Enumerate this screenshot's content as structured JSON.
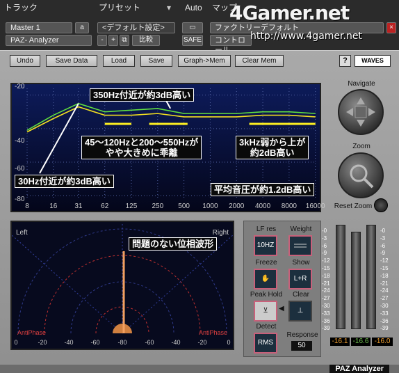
{
  "host": {
    "section_track": "トラック",
    "section_preset": "プリセット",
    "auto": "Auto",
    "section_map": "マップ",
    "track_name": "Master 1",
    "track_slot": "a",
    "insert_name": "PAZ- Analyzer",
    "preset_name": "<デフォルト設定>",
    "minus": "-",
    "plus": "+",
    "compare": "比較",
    "safe": "SAFE",
    "factory": "ファクトリーデフォルト",
    "control": "コントロール",
    "logo": "4Gamer.net",
    "url": "http://www.4gamer.net"
  },
  "toolbar": {
    "undo": "Undo",
    "save_data": "Save Data",
    "load": "Load",
    "save": "Save",
    "graph_mem": "Graph->Mem",
    "clear_mem": "Clear Mem",
    "help": "?",
    "brand": "WAVES"
  },
  "analyzer": {
    "y_labels": [
      "-20",
      "-40",
      "-60",
      "-80"
    ],
    "x_labels": [
      "8",
      "16",
      "31",
      "62",
      "125",
      "250",
      "500",
      "1000",
      "2000",
      "4000",
      "8000",
      "16000"
    ]
  },
  "chart_data": {
    "type": "line",
    "x": [
      8,
      16,
      31,
      62,
      125,
      250,
      500,
      1000,
      2000,
      4000,
      8000,
      16000
    ],
    "series": [
      {
        "values": [
          -42,
          -34,
          -27,
          -32,
          -32,
          -31,
          -33,
          -33,
          -33,
          -32,
          -32,
          -33
        ]
      },
      {
        "values": [
          -41,
          -32,
          -25,
          -30,
          -29,
          -28,
          -31,
          -31,
          -31,
          -30,
          -30,
          -31
        ]
      }
    ],
    "ylim": [
      -82,
      -16
    ],
    "xscale": "log",
    "grid": true
  },
  "annotations": {
    "a1": "350Hz付近が約3dB高い",
    "a2_line1": "45～120Hzと200～550Hzが",
    "a2_line2": "やや大きめに乖離",
    "a3_line1": "3kHz弱から上が",
    "a3_line2": "約2dB高い",
    "a4": "30Hz付近が約3dB高い",
    "a5": "平均音圧が約1.2dB高い",
    "a6": "問題のない位相波形"
  },
  "side": {
    "navigate": "Navigate",
    "zoom": "Zoom",
    "reset_zoom": "Reset Zoom"
  },
  "polar": {
    "left": "Left",
    "right": "Right",
    "antiphase_left": "AntiPhase",
    "antiphase_right": "AntiPhase",
    "scale": [
      "0",
      "-20",
      "-40",
      "-60",
      "-80",
      "-60",
      "-40",
      "-20",
      "0"
    ]
  },
  "controls": {
    "lf_res": "LF res",
    "lf_res_value": "10HZ",
    "weight": "Weight",
    "freeze": "Freeze",
    "show": "Show",
    "show_value": "L+R",
    "peak_hold": "Peak Hold",
    "clear": "Clear",
    "detect": "Detect",
    "detect_value": "RMS",
    "response": "Response",
    "response_value": "50"
  },
  "meter": {
    "scale": [
      "-0",
      "-3",
      "-6",
      "-9",
      "-12",
      "-15",
      "-18",
      "-21",
      "-24",
      "-27",
      "-30",
      "-33",
      "-36",
      "-39"
    ],
    "left": "-16.1",
    "mid": "-16.6",
    "right": "-16.0"
  },
  "footer_brand": "PAZ Analyzer"
}
